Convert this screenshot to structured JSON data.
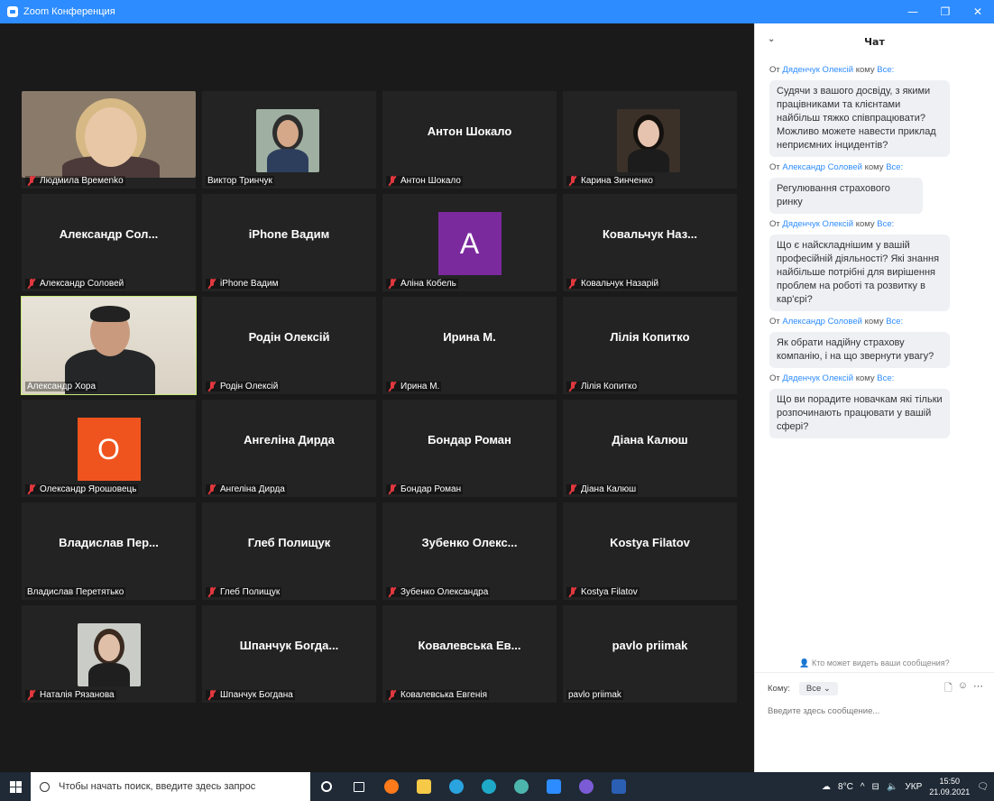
{
  "window": {
    "title": "Zoom Конференция",
    "controls": [
      "—",
      "❐",
      "✕"
    ]
  },
  "participants": [
    {
      "name": "Людмила Времеnko",
      "label": "Людмила Времеnko",
      "muted": true,
      "kind": "photo",
      "photo": "woman-glasses"
    },
    {
      "name": "Виктор Тринчук",
      "label": "Виктор Тринчук",
      "muted": false,
      "kind": "photo",
      "photo": "man-smiling"
    },
    {
      "name": "Антон Шокало",
      "label": "Антон Шокало",
      "muted": true,
      "kind": "name"
    },
    {
      "name": "Карина Зинченко",
      "label": "Карина Зинченко",
      "muted": true,
      "kind": "photo",
      "photo": "woman-dark-hair"
    },
    {
      "name": "Александр Сол...",
      "label": "Александр Соловей",
      "muted": true,
      "kind": "name"
    },
    {
      "name": "iPhone Вадим",
      "label": "iPhone Вадим",
      "muted": true,
      "kind": "name"
    },
    {
      "name": "Аліна Кобель",
      "label": "Аліна Кобель",
      "muted": true,
      "kind": "letter",
      "letter": "A",
      "color": "#7b2a9e"
    },
    {
      "name": "Ковальчук Наз...",
      "label": "Ковальчук Назарій",
      "muted": true,
      "kind": "name"
    },
    {
      "name": "Александр Хора",
      "label": "Александр Хора",
      "muted": false,
      "kind": "video",
      "active": true
    },
    {
      "name": "Родін Олексій",
      "label": "Родін Олексій",
      "muted": true,
      "kind": "name"
    },
    {
      "name": "Ирина М.",
      "label": "Ирина М.",
      "muted": true,
      "kind": "name"
    },
    {
      "name": "Лілія Копитко",
      "label": "Лілія Копитко",
      "muted": true,
      "kind": "name"
    },
    {
      "name": "Олександр Ярошовець",
      "label": "Олександр Ярошовець",
      "muted": true,
      "kind": "letter",
      "letter": "O",
      "color": "#f0541e"
    },
    {
      "name": "Ангеліна Дирда",
      "label": "Ангеліна Дирда",
      "muted": true,
      "kind": "name"
    },
    {
      "name": "Бондар Роман",
      "label": "Бондар Роман",
      "muted": true,
      "kind": "name"
    },
    {
      "name": "Діана Калюш",
      "label": "Діана Калюш",
      "muted": true,
      "kind": "name"
    },
    {
      "name": "Владислав Пер...",
      "label": "Владислав Перетятько",
      "muted": false,
      "kind": "name"
    },
    {
      "name": "Глеб Полищук",
      "label": "Глеб Полищук",
      "muted": true,
      "kind": "name"
    },
    {
      "name": "Зубенко Олекс...",
      "label": "Зубенко Олександра",
      "muted": true,
      "kind": "name"
    },
    {
      "name": "Kostya Filatov",
      "label": "Kostya Filatov",
      "muted": true,
      "kind": "name"
    },
    {
      "name": "Наталія Рязанова",
      "label": "Наталія Рязанова",
      "muted": true,
      "kind": "photo",
      "photo": "woman-long-hair"
    },
    {
      "name": "Шпанчук Богда...",
      "label": "Шпанчук Богдана",
      "muted": true,
      "kind": "name"
    },
    {
      "name": "Ковалевська Ев...",
      "label": "Ковалевська Евгенія",
      "muted": true,
      "kind": "name"
    },
    {
      "name": "pavlo priimak",
      "label": "pavlo priimak",
      "muted": false,
      "kind": "name"
    }
  ],
  "chat": {
    "title": "Чат",
    "from_word": "От",
    "to_word": "кому",
    "messages": [
      {
        "from": "Дяденчук Олексій",
        "to": "Все:",
        "text": "Судячи з вашого досвіду, з якими працівниками та клієнтами найбільш тяжко співпрацювати? Можливо можете навести приклад неприємних інцидентів?"
      },
      {
        "from": "Александр Соловей",
        "to": "Все:",
        "text": "Регулювання страхового ринку"
      },
      {
        "from": "Дяденчук Олексій",
        "to": "Все:",
        "text": "Що є найскладнішим у вашій професійній діяльності? Які знання найбільше потрібні для вирішення проблем на роботі та розвитку в кар'єрі?"
      },
      {
        "from": "Александр Соловей",
        "to": "Все:",
        "text": "Як обрати надійну страхову компанію, і на що звернути увагу?"
      },
      {
        "from": "Дяденчук Олексій",
        "to": "Все:",
        "text": "Що ви порадите новачкам які тільки розпочинають працювати у вашій сфері?"
      }
    ],
    "who_sees": "Кто может видеть ваши сообщения?",
    "to_label": "Кому:",
    "to_value": "Все",
    "input_placeholder": "Введите здесь сообщение..."
  },
  "taskbar": {
    "search_placeholder": "Чтобы начать поиск, введите здесь запрос",
    "weather": "8°C",
    "lang": "УКР",
    "time": "15:50",
    "date": "21.09.2021"
  }
}
